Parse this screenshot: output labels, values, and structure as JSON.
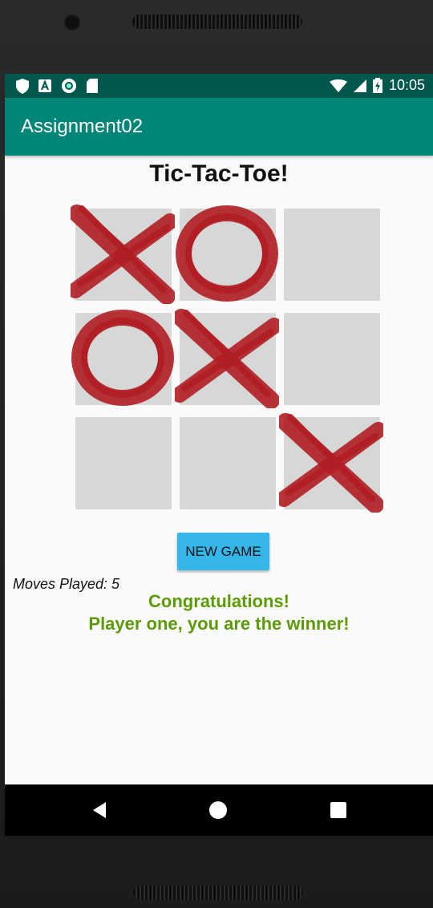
{
  "status_bar": {
    "time": "10:05",
    "left_icons": [
      "shield-icon",
      "a-icon",
      "circle-icon",
      "sd-card-icon"
    ],
    "right_icons": [
      "wifi-icon",
      "signal-icon",
      "battery-icon"
    ]
  },
  "app_bar": {
    "title": "Assignment02"
  },
  "game": {
    "title": "Tic-Tac-Toe!",
    "board": [
      "X",
      "O",
      "",
      "O",
      "X",
      "",
      "",
      "",
      "X"
    ],
    "mark_color": "#b01e23",
    "cell_color": "#d6d7d7",
    "new_game_label": "NEW GAME",
    "moves_played": "Moves Played: 5",
    "result_line1": "Congratulations!",
    "result_line2": "Player one, you are the winner!",
    "result_color": "#5c9a06"
  },
  "nav_bar": {
    "icons": [
      "back-icon",
      "home-icon",
      "recents-icon"
    ]
  },
  "colors": {
    "primary": "#008577",
    "primary_dark": "#00574b",
    "button": "#35b6e8"
  }
}
